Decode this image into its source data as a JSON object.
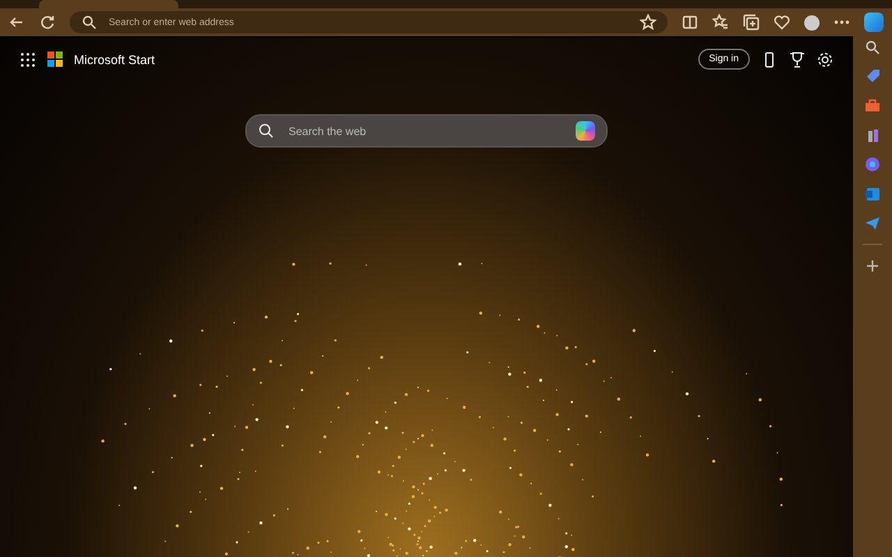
{
  "browser": {
    "address_bar": {
      "placeholder": "Search or enter web address"
    }
  },
  "page": {
    "brand": "Microsoft Start",
    "sign_in": "Sign in",
    "search": {
      "placeholder": "Search the web"
    }
  }
}
